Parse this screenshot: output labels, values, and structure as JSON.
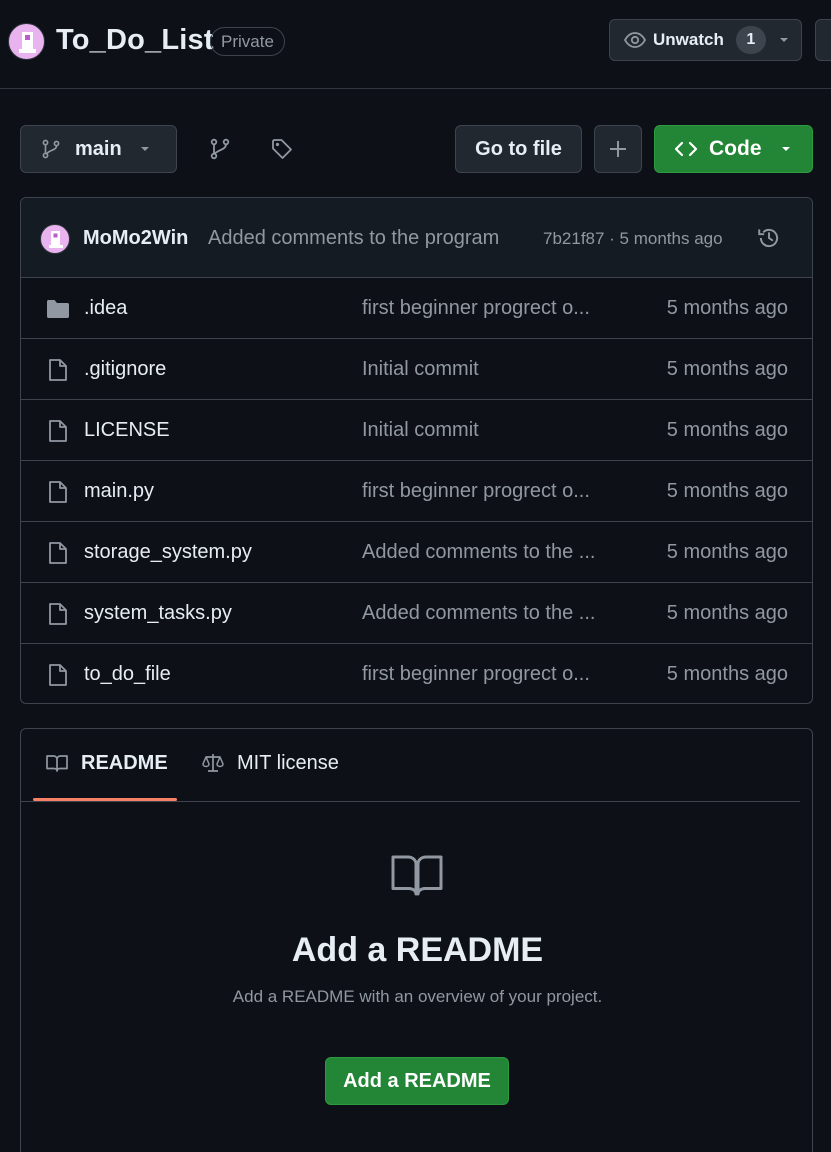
{
  "header": {
    "repo_name": "To_Do_List",
    "visibility": "Private",
    "unwatch_label": "Unwatch",
    "watch_count": "1"
  },
  "toolbar": {
    "branch": "main",
    "go_to_file": "Go to file",
    "code_label": "Code"
  },
  "latest_commit": {
    "author": "MoMo2Win",
    "message": "Added comments to the program",
    "meta": "7b21f87 · 5 months ago"
  },
  "files": [
    {
      "name": ".idea",
      "type": "folder",
      "message": "first beginner progrect o...",
      "age": "5 months ago"
    },
    {
      "name": ".gitignore",
      "type": "file",
      "message": "Initial commit",
      "age": "5 months ago"
    },
    {
      "name": "LICENSE",
      "type": "file",
      "message": "Initial commit",
      "age": "5 months ago"
    },
    {
      "name": "main.py",
      "type": "file",
      "message": "first beginner progrect o...",
      "age": "5 months ago"
    },
    {
      "name": "storage_system.py",
      "type": "file",
      "message": "Added comments to the ...",
      "age": "5 months ago"
    },
    {
      "name": "system_tasks.py",
      "type": "file",
      "message": "Added comments to the ...",
      "age": "5 months ago"
    },
    {
      "name": "to_do_file",
      "type": "file",
      "message": "first beginner progrect o...",
      "age": "5 months ago"
    }
  ],
  "readme": {
    "tab_readme": "README",
    "tab_license": "MIT license",
    "title": "Add a README",
    "subtitle": "Add a README with an overview of your project.",
    "button": "Add a README"
  },
  "colors": {
    "background": "#0d1117",
    "border": "#3d444d",
    "primary_button": "#238636",
    "muted_text": "#9198a1",
    "tab_underline": "#f78166"
  }
}
